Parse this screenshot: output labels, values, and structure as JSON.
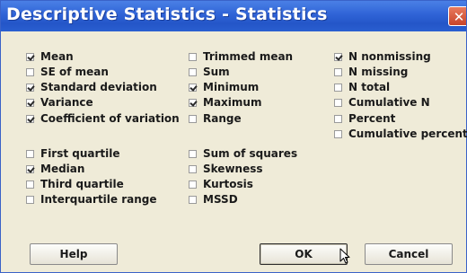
{
  "window": {
    "title": "Descriptive Statistics - Statistics"
  },
  "icons": {
    "close": "close-icon",
    "cursor": "mouse-pointer-icon"
  },
  "options": {
    "col1": [
      {
        "label": "Mean",
        "checked": true
      },
      {
        "label": "SE of mean",
        "checked": false
      },
      {
        "label": "Standard deviation",
        "checked": true
      },
      {
        "label": "Variance",
        "checked": true
      },
      {
        "label": "Coefficient of variation",
        "checked": true
      },
      {
        "label": "First quartile",
        "checked": false
      },
      {
        "label": "Median",
        "checked": true
      },
      {
        "label": "Third quartile",
        "checked": false
      },
      {
        "label": "Interquartile range",
        "checked": false
      }
    ],
    "col2": [
      {
        "label": "Trimmed mean",
        "checked": false
      },
      {
        "label": "Sum",
        "checked": false
      },
      {
        "label": "Minimum",
        "checked": true
      },
      {
        "label": "Maximum",
        "checked": true
      },
      {
        "label": "Range",
        "checked": false
      },
      {
        "label": "Sum of squares",
        "checked": false
      },
      {
        "label": "Skewness",
        "checked": false
      },
      {
        "label": "Kurtosis",
        "checked": false
      },
      {
        "label": "MSSD",
        "checked": false
      }
    ],
    "col3": [
      {
        "label": "N nonmissing",
        "checked": true
      },
      {
        "label": "N missing",
        "checked": false
      },
      {
        "label": "N total",
        "checked": false
      },
      {
        "label": "Cumulative N",
        "checked": false
      },
      {
        "label": "Percent",
        "checked": false
      },
      {
        "label": "Cumulative percent",
        "checked": false
      }
    ]
  },
  "buttons": {
    "help": "Help",
    "ok": "OK",
    "cancel": "Cancel"
  }
}
